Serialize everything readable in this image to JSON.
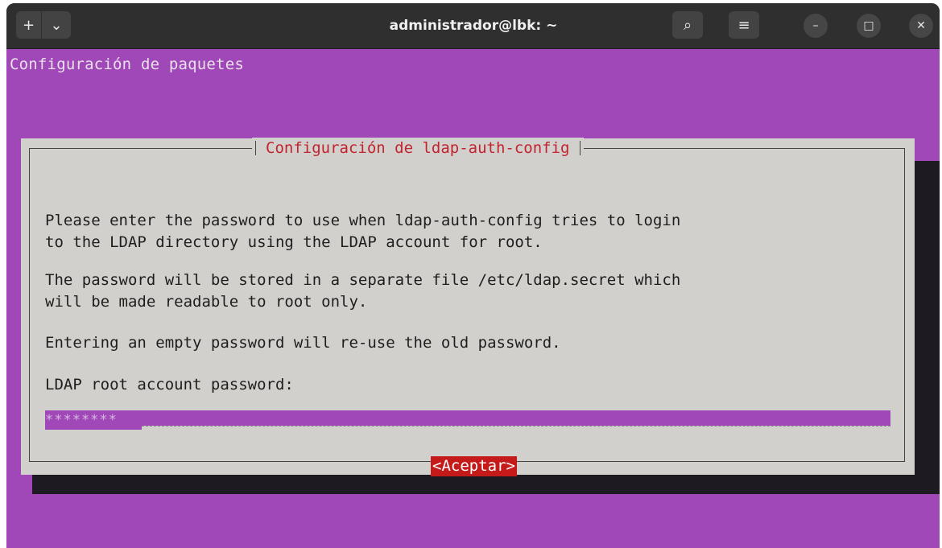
{
  "window": {
    "title": "administrador@lbk: ~"
  },
  "titlebar_icons": {
    "new_tab": "+",
    "menu_dropdown": "⌄",
    "search": "⌕",
    "hamburger": "≡",
    "minimize": "–",
    "maximize": "□",
    "close": "✕"
  },
  "terminal": {
    "header": "Configuración de paquetes"
  },
  "dialog": {
    "title": "Configuración de ldap-auth-config",
    "lines": [
      "Please enter the password to use when ldap-auth-config tries to login",
      "to the LDAP directory using the LDAP account for root.",
      "The password will be stored in a separate file /etc/ldap.secret which",
      "will be made readable to root only.",
      "Entering an empty password will re-use the old password.",
      "LDAP root account password:"
    ],
    "password_value": "********",
    "ok_button": "<Aceptar>"
  },
  "colors": {
    "terminal_bg": "#a048b8",
    "dialog_bg": "#d2d0cc",
    "dialog_title": "#c2232e",
    "button_bg": "#c41a1a"
  }
}
